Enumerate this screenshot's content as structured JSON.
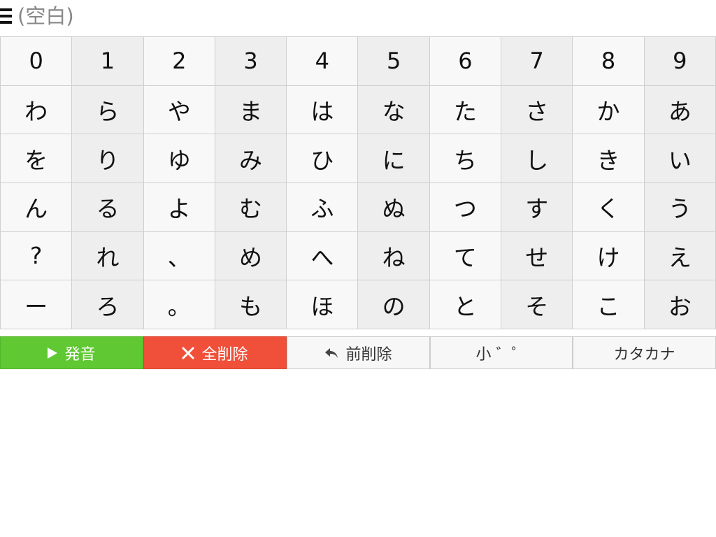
{
  "header": {
    "display_text": "(空白)",
    "menu_icon": "menu-icon"
  },
  "keyboard": {
    "rows": [
      [
        "0",
        "1",
        "2",
        "3",
        "4",
        "5",
        "6",
        "7",
        "8",
        "9"
      ],
      [
        "わ",
        "ら",
        "や",
        "ま",
        "は",
        "な",
        "た",
        "さ",
        "か",
        "あ"
      ],
      [
        "を",
        "り",
        "ゆ",
        "み",
        "ひ",
        "に",
        "ち",
        "し",
        "き",
        "い"
      ],
      [
        "ん",
        "る",
        "よ",
        "む",
        "ふ",
        "ぬ",
        "つ",
        "す",
        "く",
        "う"
      ],
      [
        "?",
        "れ",
        "、",
        "め",
        "へ",
        "ね",
        "て",
        "せ",
        "け",
        "え"
      ],
      [
        "ー",
        "ろ",
        "。",
        "も",
        "ほ",
        "の",
        "と",
        "そ",
        "こ",
        "お"
      ]
    ]
  },
  "toolbar": {
    "speak_label": "発音",
    "speak_icon": "play-icon",
    "clear_label": "全削除",
    "clear_icon": "close-icon",
    "backspace_label": "前削除",
    "backspace_icon": "undo-arrow-icon",
    "small_label": "小 ゛゜",
    "katakana_label": "カタカナ"
  },
  "colors": {
    "speak": "#60c832",
    "clear": "#f0503a",
    "key_light": "#f8f8f8",
    "key_dark": "#eeeeee",
    "placeholder_text": "#888888"
  }
}
